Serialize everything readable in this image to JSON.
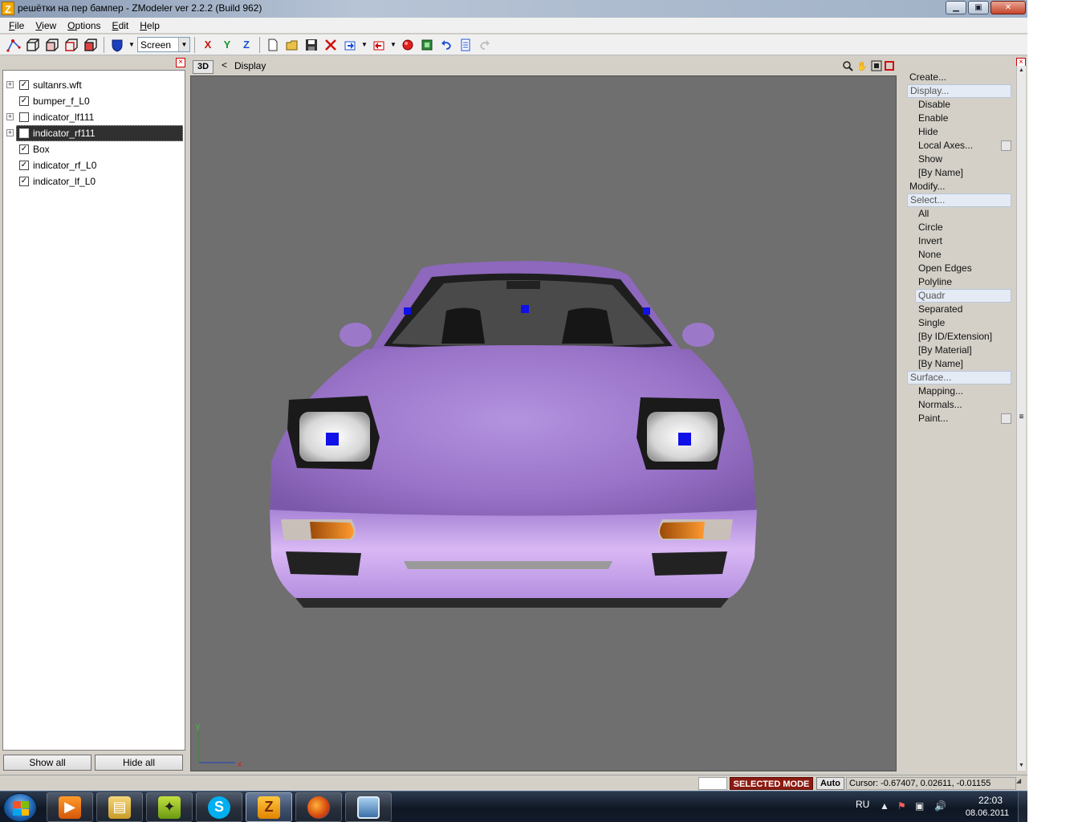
{
  "window": {
    "title": "решётки на пер бампер - ZModeler ver 2.2.2 (Build 962)",
    "app_icon_letter": "Z",
    "minimize_glyph": "▁",
    "maximize_glyph": "▣",
    "close_glyph": "✕"
  },
  "menu": [
    {
      "label": "File",
      "u": "F",
      "rest": "ile"
    },
    {
      "label": "View",
      "u": "V",
      "rest": "iew"
    },
    {
      "label": "Options",
      "u": "O",
      "rest": "ptions"
    },
    {
      "label": "Edit",
      "u": "E",
      "rest": "dit"
    },
    {
      "label": "Help",
      "u": "H",
      "rest": "elp"
    }
  ],
  "toolbar": {
    "view_mode": "Screen",
    "axis_x": "X",
    "axis_y": "Y",
    "axis_z": "Z"
  },
  "scene_tree": {
    "nodes": [
      {
        "label": "sultanrs.wft",
        "checked": true,
        "expandable": true,
        "selected": false
      },
      {
        "label": "bumper_f_L0",
        "checked": true,
        "expandable": false,
        "selected": false
      },
      {
        "label": "indicator_lf111",
        "checked": false,
        "expandable": true,
        "selected": false
      },
      {
        "label": "indicator_rf111",
        "checked": false,
        "expandable": true,
        "selected": true
      },
      {
        "label": "Box",
        "checked": true,
        "expandable": false,
        "selected": false
      },
      {
        "label": "indicator_rf_L0",
        "checked": true,
        "expandable": false,
        "selected": false
      },
      {
        "label": "indicator_lf_L0",
        "checked": true,
        "expandable": false,
        "selected": false
      }
    ],
    "show_all": "Show all",
    "hide_all": "Hide all"
  },
  "viewport": {
    "mode_button": "3D",
    "back_glyph": "<",
    "breadcrumb": "Display",
    "axis_label_x": "x",
    "axis_label_y": "y",
    "body_color": "#a27fd1",
    "background_color": "#6f6f6f"
  },
  "command_panel": {
    "items": [
      {
        "label": "Create...",
        "kind": "header",
        "selected": false
      },
      {
        "label": "Display...",
        "kind": "header",
        "selected": true
      },
      {
        "label": "Disable",
        "kind": "sub"
      },
      {
        "label": "Enable",
        "kind": "sub"
      },
      {
        "label": "Hide",
        "kind": "sub"
      },
      {
        "label": "Local Axes...",
        "kind": "sub",
        "has_check": true
      },
      {
        "label": "Show",
        "kind": "sub"
      },
      {
        "label": "[By Name]",
        "kind": "sub"
      },
      {
        "label": "Modify...",
        "kind": "header",
        "selected": false
      },
      {
        "label": "Select...",
        "kind": "header",
        "selected": true
      },
      {
        "label": "All",
        "kind": "sub"
      },
      {
        "label": "Circle",
        "kind": "sub"
      },
      {
        "label": "Invert",
        "kind": "sub"
      },
      {
        "label": "None",
        "kind": "sub"
      },
      {
        "label": "Open Edges",
        "kind": "sub"
      },
      {
        "label": "Polyline",
        "kind": "sub"
      },
      {
        "label": "Quadr",
        "kind": "sub",
        "highlighted": true
      },
      {
        "label": "Separated",
        "kind": "sub"
      },
      {
        "label": "Single",
        "kind": "sub"
      },
      {
        "label": "[By ID/Extension]",
        "kind": "sub"
      },
      {
        "label": "[By Material]",
        "kind": "sub"
      },
      {
        "label": "[By Name]",
        "kind": "sub"
      },
      {
        "label": "Surface...",
        "kind": "header",
        "selected": true
      },
      {
        "label": "Mapping...",
        "kind": "sub"
      },
      {
        "label": "Normals...",
        "kind": "sub"
      },
      {
        "label": "Paint...",
        "kind": "sub",
        "has_check": true
      }
    ]
  },
  "status": {
    "mode": "SELECTED MODE",
    "auto": "Auto",
    "cursor": "Cursor: -0.67407, 0.02611, -0.01155"
  },
  "taskbar": {
    "language": "RU",
    "time": "22:03",
    "date": "08.06.2011"
  }
}
